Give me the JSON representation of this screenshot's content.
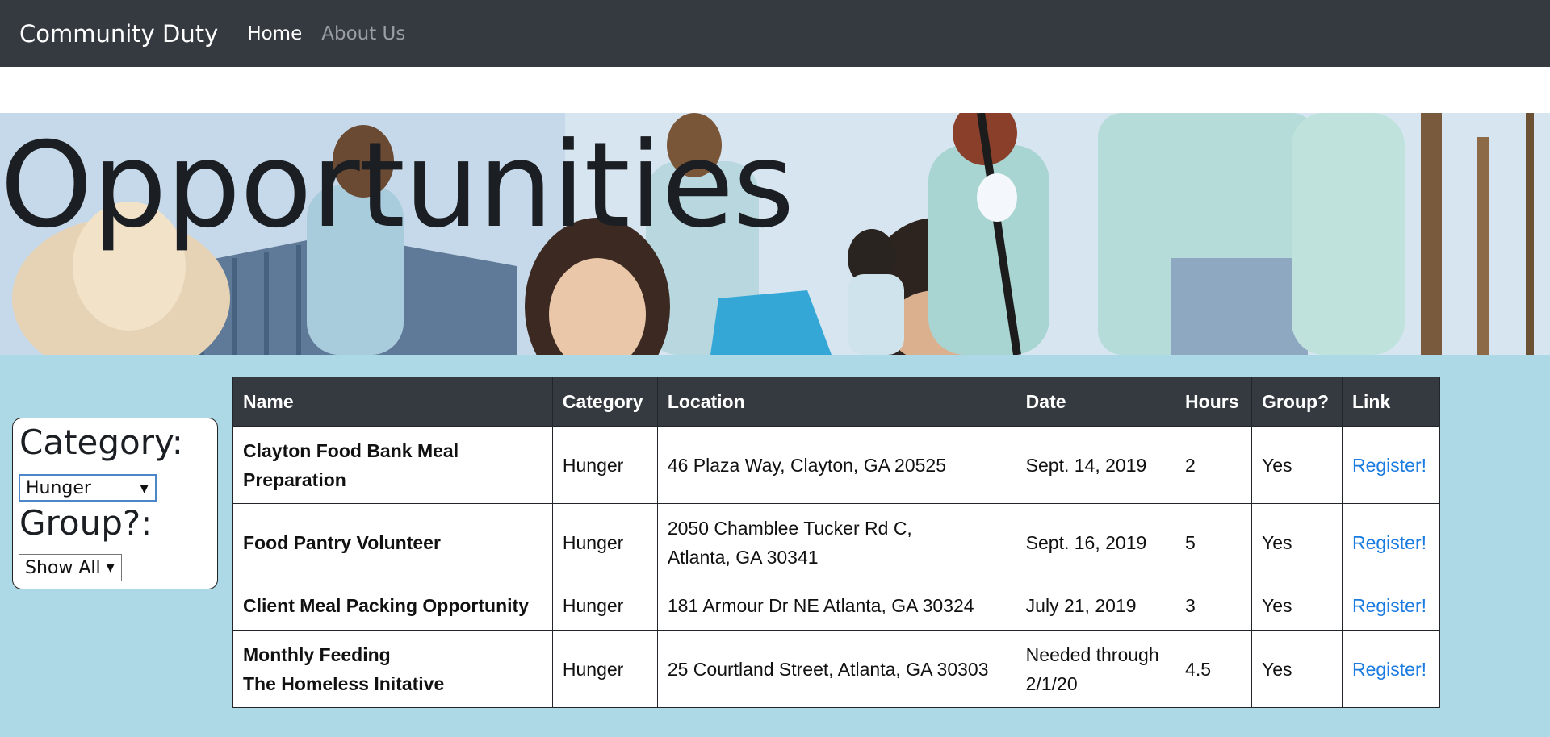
{
  "navbar": {
    "brand": "Community Duty",
    "links": [
      {
        "label": "Home",
        "active": true
      },
      {
        "label": "About Us",
        "active": false
      }
    ],
    "background": "#343a40"
  },
  "hero": {
    "title": "Opportunities"
  },
  "filters": {
    "category_label": "Category:",
    "category_value": "Hunger",
    "group_label": "Group?:",
    "group_value": "Show All"
  },
  "table": {
    "headers": [
      "Name",
      "Category",
      "Location",
      "Date",
      "Hours",
      "Group?",
      "Link"
    ],
    "rows": [
      {
        "name_line1": "Clayton Food Bank Meal",
        "name_line2": "Preparation",
        "category": "Hunger",
        "location_line1": "46 Plaza Way, Clayton, GA 20525",
        "location_line2": "",
        "date_line1": "Sept. 14, 2019",
        "date_line2": "",
        "hours": "2",
        "group": "Yes",
        "link": "Register!"
      },
      {
        "name_line1": "Food Pantry Volunteer",
        "name_line2": "",
        "category": "Hunger",
        "location_line1": "2050 Chamblee Tucker Rd C,",
        "location_line2": "Atlanta, GA 30341",
        "date_line1": "Sept. 16, 2019",
        "date_line2": "",
        "hours": "5",
        "group": "Yes",
        "link": "Register!"
      },
      {
        "name_line1": "Client Meal Packing Opportunity",
        "name_line2": "",
        "category": "Hunger",
        "location_line1": "181 Armour Dr NE Atlanta, GA 30324",
        "location_line2": "",
        "date_line1": "July 21, 2019",
        "date_line2": "",
        "hours": "3",
        "group": "Yes",
        "link": "Register!"
      },
      {
        "name_line1": "Monthly Feeding",
        "name_line2": "The Homeless Initative",
        "category": "Hunger",
        "location_line1": "25 Courtland Street, Atlanta, GA 30303",
        "location_line2": "",
        "date_line1": "Needed through",
        "date_line2": "2/1/20",
        "hours": "4.5",
        "group": "Yes",
        "link": "Register!"
      }
    ]
  },
  "colors": {
    "content_background": "#add8e6",
    "link": "#1a7be0",
    "header_background": "#343a40"
  }
}
